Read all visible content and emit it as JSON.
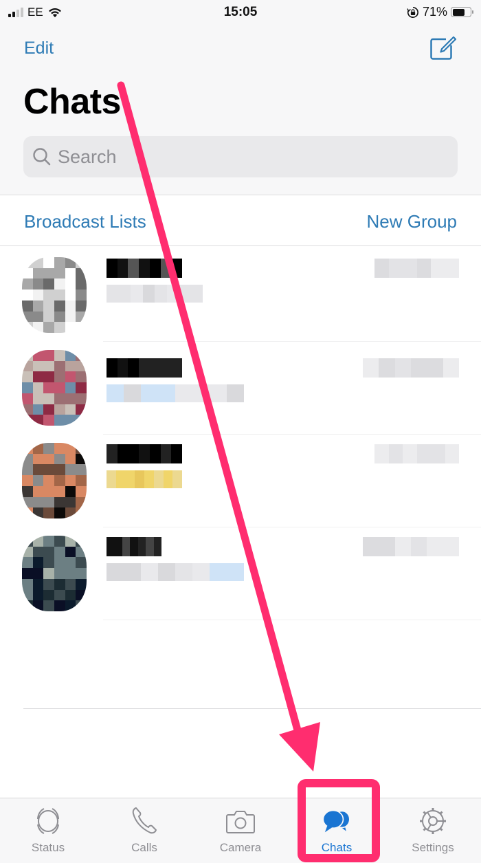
{
  "status_bar": {
    "carrier": "EE",
    "time": "15:05",
    "battery_percent": "71%",
    "battery_level": 0.71,
    "signal_bars_active": 2,
    "signal_bars_total": 4,
    "icons": [
      "signal-icon",
      "wifi-icon",
      "rotation-lock-icon",
      "battery-icon"
    ]
  },
  "header": {
    "edit_label": "Edit",
    "title": "Chats",
    "compose_icon": "compose-icon",
    "accent_color": "#2e7bb5"
  },
  "search": {
    "placeholder": "Search",
    "value": ""
  },
  "actions": {
    "broadcast_label": "Broadcast Lists",
    "new_group_label": "New Group"
  },
  "chats": [
    {
      "name": "[redacted]",
      "preview": "[redacted]",
      "time": "[redacted]",
      "avatar_palette": [
        "#f2f2f2",
        "#d0d0d0",
        "#a8a8a8",
        "#8a8a8a",
        "#6a6a6a",
        "#ffffff"
      ]
    },
    {
      "name": "[redacted]",
      "preview": "[redacted]",
      "time": "[redacted]",
      "avatar_palette": [
        "#c9c0b8",
        "#9c6f73",
        "#c2566f",
        "#8e2a44",
        "#6e8ea8",
        "#b9a39d"
      ]
    },
    {
      "name": "[redacted]",
      "preview": "[redacted]",
      "time": "[redacted]",
      "avatar_palette": [
        "#3b3634",
        "#0c0a09",
        "#6b4a3a",
        "#a36648",
        "#d98863",
        "#8b8b8b"
      ]
    },
    {
      "name": "[redacted]",
      "preview": "[redacted]",
      "time": "[redacted]",
      "avatar_palette": [
        "#1c2c33",
        "#0b1b2c",
        "#3c4b50",
        "#6c7f83",
        "#0a0f25",
        "#a8b2a9"
      ]
    }
  ],
  "tabs": [
    {
      "label": "Status",
      "icon": "status-icon",
      "active": false
    },
    {
      "label": "Calls",
      "icon": "phone-icon",
      "active": false
    },
    {
      "label": "Camera",
      "icon": "camera-icon",
      "active": false
    },
    {
      "label": "Chats",
      "icon": "chat-bubbles-icon",
      "active": true
    },
    {
      "label": "Settings",
      "icon": "gear-icon",
      "active": false
    }
  ],
  "annotation": {
    "color": "#ff2d6f",
    "description": "arrow pointing to highlighted Chats tab"
  }
}
